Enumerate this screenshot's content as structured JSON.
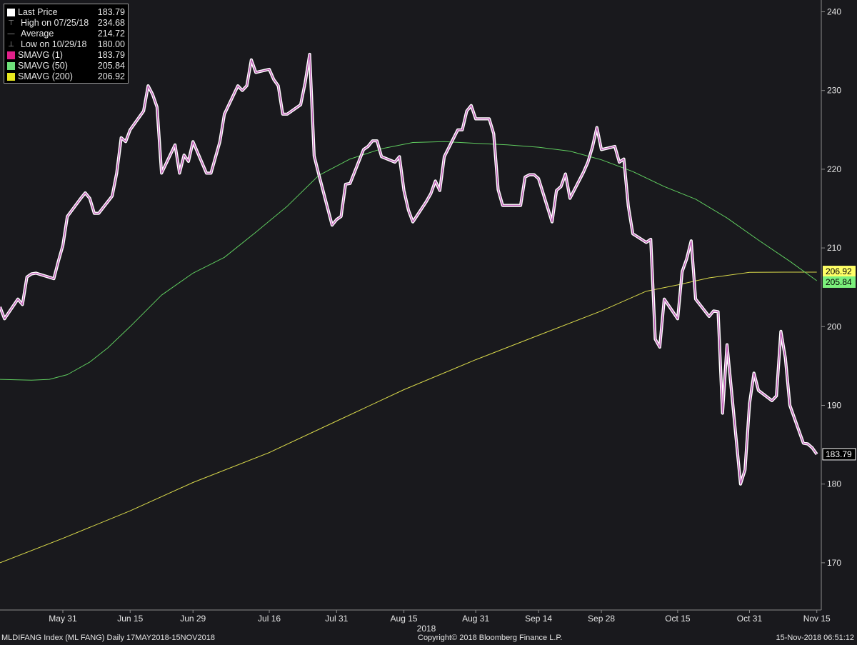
{
  "colors": {
    "background": "#19191d",
    "price": "#f2b6f0",
    "price_casing": "#ffffff",
    "sma50": "#5fcc5f",
    "sma200": "#d8d84a",
    "axis": "#8c8c8c",
    "text": "#e6e6e6"
  },
  "legend": {
    "rows": [
      {
        "label": "Last Price",
        "value": "183.79",
        "icon": "white-square-icon",
        "swatch": "#ffffff",
        "indent": false
      },
      {
        "label": "High on 07/25/18",
        "value": "234.68",
        "icon": "high-marker-icon",
        "swatch": "",
        "indent": true
      },
      {
        "label": "Average",
        "value": "214.72",
        "icon": "average-marker-icon",
        "swatch": "",
        "indent": true
      },
      {
        "label": "Low on 10/29/18",
        "value": "180.00",
        "icon": "low-marker-icon",
        "swatch": "",
        "indent": true
      },
      {
        "label": "SMAVG (1)",
        "value": "183.79",
        "icon": "pink-square-icon",
        "swatch": "#e0208a",
        "indent": false
      },
      {
        "label": "SMAVG (50)",
        "value": "205.84",
        "icon": "green-square-icon",
        "swatch": "#6ee07a",
        "indent": false
      },
      {
        "label": "SMAVG (200)",
        "value": "206.92",
        "icon": "yellow-square-icon",
        "swatch": "#e8e820",
        "indent": false
      }
    ]
  },
  "footer": {
    "left": "MLDIFANG Index (ML FANG)  Daily 17MAY2018-15NOV2018",
    "center": "Copyright© 2018 Bloomberg Finance L.P.",
    "right": "15-Nov-2018 06:51:12"
  },
  "chart_data": {
    "type": "line",
    "x_ticks": [
      "May 31",
      "Jun 15",
      "Jun 29",
      "Jul 16",
      "Jul 31",
      "Aug 15",
      "Aug 31",
      "Sep 14",
      "Sep 28",
      "Oct 15",
      "Oct 31",
      "Nov 15"
    ],
    "x_year_label": "2018",
    "y_ticks": [
      170,
      180,
      190,
      200,
      210,
      220,
      230,
      240
    ],
    "ylim": [
      164,
      241.5
    ],
    "xlim": [
      "2018-05-17",
      "2018-11-16"
    ],
    "series": [
      {
        "name": "SMAVG (1)",
        "color": "#f2b6f0",
        "last_value_label": "183.79",
        "points": [
          [
            "2018-05-17",
            202.5
          ],
          [
            "2018-05-18",
            201.0
          ],
          [
            "2018-05-21",
            203.5
          ],
          [
            "2018-05-22",
            202.8
          ],
          [
            "2018-05-23",
            206.3
          ],
          [
            "2018-05-24",
            206.7
          ],
          [
            "2018-05-25",
            206.8
          ],
          [
            "2018-05-29",
            206.1
          ],
          [
            "2018-05-30",
            208.3
          ],
          [
            "2018-05-31",
            210.3
          ],
          [
            "2018-06-01",
            214.0
          ],
          [
            "2018-06-04",
            216.3
          ],
          [
            "2018-06-05",
            217.0
          ],
          [
            "2018-06-06",
            216.3
          ],
          [
            "2018-06-07",
            214.4
          ],
          [
            "2018-06-08",
            214.4
          ],
          [
            "2018-06-11",
            216.6
          ],
          [
            "2018-06-12",
            219.5
          ],
          [
            "2018-06-13",
            224.0
          ],
          [
            "2018-06-14",
            223.5
          ],
          [
            "2018-06-15",
            225.0
          ],
          [
            "2018-06-18",
            227.4
          ],
          [
            "2018-06-19",
            230.6
          ],
          [
            "2018-06-20",
            229.5
          ],
          [
            "2018-06-21",
            227.9
          ],
          [
            "2018-06-22",
            219.5
          ],
          [
            "2018-06-25",
            223.1
          ],
          [
            "2018-06-26",
            219.5
          ],
          [
            "2018-06-27",
            221.8
          ],
          [
            "2018-06-28",
            221.0
          ],
          [
            "2018-06-29",
            223.5
          ],
          [
            "2018-07-02",
            219.5
          ],
          [
            "2018-07-03",
            219.5
          ],
          [
            "2018-07-05",
            223.5
          ],
          [
            "2018-07-06",
            227.0
          ],
          [
            "2018-07-09",
            230.6
          ],
          [
            "2018-07-10",
            230.0
          ],
          [
            "2018-07-11",
            230.6
          ],
          [
            "2018-07-12",
            233.9
          ],
          [
            "2018-07-13",
            232.3
          ],
          [
            "2018-07-16",
            232.7
          ],
          [
            "2018-07-17",
            231.4
          ],
          [
            "2018-07-18",
            230.6
          ],
          [
            "2018-07-19",
            227.0
          ],
          [
            "2018-07-20",
            227.0
          ],
          [
            "2018-07-23",
            228.2
          ],
          [
            "2018-07-24",
            231.0
          ],
          [
            "2018-07-25",
            234.6
          ],
          [
            "2018-07-26",
            221.7
          ],
          [
            "2018-07-27",
            219.4
          ],
          [
            "2018-07-30",
            212.9
          ],
          [
            "2018-07-31",
            213.6
          ],
          [
            "2018-08-01",
            214.0
          ],
          [
            "2018-08-02",
            218.1
          ],
          [
            "2018-08-03",
            218.2
          ],
          [
            "2018-08-06",
            222.5
          ],
          [
            "2018-08-07",
            222.9
          ],
          [
            "2018-08-08",
            223.6
          ],
          [
            "2018-08-09",
            223.6
          ],
          [
            "2018-08-10",
            221.6
          ],
          [
            "2018-08-13",
            220.9
          ],
          [
            "2018-08-14",
            221.6
          ],
          [
            "2018-08-15",
            217.3
          ],
          [
            "2018-08-16",
            214.8
          ],
          [
            "2018-08-17",
            213.3
          ],
          [
            "2018-08-20",
            215.9
          ],
          [
            "2018-08-21",
            216.9
          ],
          [
            "2018-08-22",
            218.5
          ],
          [
            "2018-08-23",
            217.3
          ],
          [
            "2018-08-24",
            221.6
          ],
          [
            "2018-08-27",
            225.0
          ],
          [
            "2018-08-28",
            225.0
          ],
          [
            "2018-08-29",
            227.4
          ],
          [
            "2018-08-30",
            228.1
          ],
          [
            "2018-08-31",
            226.4
          ],
          [
            "2018-09-03",
            226.4
          ],
          [
            "2018-09-04",
            224.5
          ],
          [
            "2018-09-05",
            217.4
          ],
          [
            "2018-09-06",
            215.4
          ],
          [
            "2018-09-07",
            215.4
          ],
          [
            "2018-09-10",
            215.4
          ],
          [
            "2018-09-11",
            219.0
          ],
          [
            "2018-09-12",
            219.3
          ],
          [
            "2018-09-13",
            219.3
          ],
          [
            "2018-09-14",
            218.8
          ],
          [
            "2018-09-17",
            213.3
          ],
          [
            "2018-09-18",
            217.3
          ],
          [
            "2018-09-19",
            217.8
          ],
          [
            "2018-09-20",
            219.4
          ],
          [
            "2018-09-21",
            216.3
          ],
          [
            "2018-09-24",
            219.6
          ],
          [
            "2018-09-25",
            220.9
          ],
          [
            "2018-09-26",
            222.8
          ],
          [
            "2018-09-27",
            225.3
          ],
          [
            "2018-09-28",
            222.5
          ],
          [
            "2018-10-01",
            222.9
          ],
          [
            "2018-10-02",
            220.9
          ],
          [
            "2018-10-03",
            221.3
          ],
          [
            "2018-10-04",
            215.3
          ],
          [
            "2018-10-05",
            211.8
          ],
          [
            "2018-10-08",
            210.7
          ],
          [
            "2018-10-09",
            211.1
          ],
          [
            "2018-10-10",
            198.4
          ],
          [
            "2018-10-11",
            197.4
          ],
          [
            "2018-10-12",
            203.5
          ],
          [
            "2018-10-15",
            201.0
          ],
          [
            "2018-10-16",
            207.0
          ],
          [
            "2018-10-17",
            208.6
          ],
          [
            "2018-10-18",
            210.9
          ],
          [
            "2018-10-19",
            203.5
          ],
          [
            "2018-10-22",
            201.3
          ],
          [
            "2018-10-23",
            202.0
          ],
          [
            "2018-10-24",
            201.9
          ],
          [
            "2018-10-25",
            189.0
          ],
          [
            "2018-10-26",
            197.7
          ],
          [
            "2018-10-29",
            180.0
          ],
          [
            "2018-10-30",
            181.8
          ],
          [
            "2018-10-31",
            190.2
          ],
          [
            "2018-11-01",
            194.1
          ],
          [
            "2018-11-02",
            191.9
          ],
          [
            "2018-11-05",
            190.6
          ],
          [
            "2018-11-06",
            191.2
          ],
          [
            "2018-11-07",
            199.4
          ],
          [
            "2018-11-08",
            196.0
          ],
          [
            "2018-11-09",
            190.0
          ],
          [
            "2018-11-12",
            185.2
          ],
          [
            "2018-11-13",
            185.1
          ],
          [
            "2018-11-14",
            184.6
          ],
          [
            "2018-11-15",
            183.79
          ]
        ]
      },
      {
        "name": "SMAVG (50)",
        "color": "#5fcc5f",
        "last_value_label": "205.84",
        "points": [
          [
            "2018-05-17",
            193.3
          ],
          [
            "2018-05-24",
            193.2
          ],
          [
            "2018-05-28",
            193.3
          ],
          [
            "2018-06-01",
            193.9
          ],
          [
            "2018-06-06",
            195.5
          ],
          [
            "2018-06-10",
            197.3
          ],
          [
            "2018-06-15",
            200.0
          ],
          [
            "2018-06-22",
            204.0
          ],
          [
            "2018-06-29",
            206.8
          ],
          [
            "2018-07-06",
            208.8
          ],
          [
            "2018-07-13",
            212.0
          ],
          [
            "2018-07-20",
            215.3
          ],
          [
            "2018-07-27",
            219.2
          ],
          [
            "2018-08-03",
            221.3
          ],
          [
            "2018-08-10",
            222.6
          ],
          [
            "2018-08-17",
            223.4
          ],
          [
            "2018-08-24",
            223.5
          ],
          [
            "2018-08-31",
            223.3
          ],
          [
            "2018-09-07",
            223.1
          ],
          [
            "2018-09-14",
            222.8
          ],
          [
            "2018-09-21",
            222.3
          ],
          [
            "2018-09-28",
            221.2
          ],
          [
            "2018-10-05",
            219.7
          ],
          [
            "2018-10-12",
            217.8
          ],
          [
            "2018-10-19",
            216.2
          ],
          [
            "2018-10-26",
            213.8
          ],
          [
            "2018-11-02",
            211.0
          ],
          [
            "2018-11-09",
            208.3
          ],
          [
            "2018-11-15",
            205.84
          ]
        ]
      },
      {
        "name": "SMAVG (200)",
        "color": "#d8d84a",
        "last_value_label": "206.92",
        "points": [
          [
            "2018-05-17",
            170.0
          ],
          [
            "2018-05-31",
            173.1
          ],
          [
            "2018-06-15",
            176.6
          ],
          [
            "2018-06-29",
            180.2
          ],
          [
            "2018-07-16",
            184.0
          ],
          [
            "2018-07-31",
            188.0
          ],
          [
            "2018-08-15",
            192.0
          ],
          [
            "2018-08-31",
            195.8
          ],
          [
            "2018-09-14",
            198.9
          ],
          [
            "2018-09-28",
            202.0
          ],
          [
            "2018-10-08",
            204.5
          ],
          [
            "2018-10-15",
            205.3
          ],
          [
            "2018-10-22",
            206.2
          ],
          [
            "2018-10-31",
            206.9
          ],
          [
            "2018-11-08",
            206.92
          ],
          [
            "2018-11-15",
            206.92
          ]
        ]
      }
    ]
  }
}
